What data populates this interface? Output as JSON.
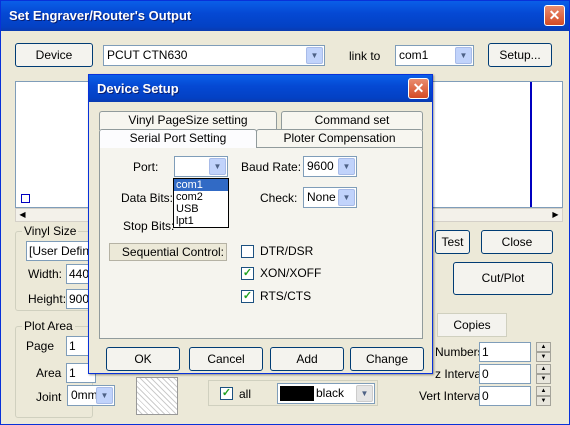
{
  "main": {
    "title": "Set Engraver/Router's Output",
    "device_button": "Device",
    "device_value": "PCUT CTN630",
    "link_to_label": "link to",
    "link_value": "com1",
    "setup_button": "Setup...",
    "vinyl_size_label": "Vinyl Size",
    "vinyl_type_value": "[User Define",
    "width_label": "Width:",
    "width_value": "440",
    "height_label": "Height:",
    "height_value": "900",
    "plot_area_label": "Plot Area",
    "page_label": "Page",
    "page_value": "1",
    "area_label": "Area",
    "area_value": "1",
    "joint_label": "Joint",
    "joint_value": "0mm",
    "test_button": "Test",
    "close_button": "Close",
    "cut_plot_button": "Cut/Plot",
    "copies_button": "Copies",
    "numbers_label": "Numbers",
    "numbers_value": "1",
    "z_interval_label": "z Interval",
    "z_interval_value": "0",
    "vert_interval_label": "Vert Interval",
    "vert_interval_value": "0",
    "all_label": "all",
    "color_value": "black"
  },
  "dialog": {
    "title": "Device Setup",
    "tabs": [
      {
        "label": "Vinyl PageSize setting"
      },
      {
        "label": "Command set"
      },
      {
        "label": "Serial Port Setting"
      },
      {
        "label": "Ploter Compensation"
      }
    ],
    "port_label": "Port:",
    "port_options": [
      "com1",
      "com2",
      "USB",
      "lpt1"
    ],
    "data_bits_label": "Data Bits:",
    "stop_bits_label": "Stop Bits:",
    "baud_rate_label": "Baud Rate:",
    "baud_rate_value": "9600",
    "check_label": "Check:",
    "check_value": "None",
    "sequential_control_label": "Sequential Control:",
    "dtr_dsr_label": "DTR/DSR",
    "dtr_dsr_checked": false,
    "xon_xoff_label": "XON/XOFF",
    "xon_xoff_checked": true,
    "rts_cts_label": "RTS/CTS",
    "rts_cts_checked": true,
    "ok_button": "OK",
    "cancel_button": "Cancel",
    "add_button": "Add",
    "change_button": "Change"
  },
  "icons": {
    "close": "close-icon",
    "dropdown": "chevron-down-icon",
    "check": "checkmark-icon"
  },
  "colors": {
    "titlebar": "#0549d4",
    "selection": "#316ac5",
    "window_bg": "#ece9d8"
  }
}
